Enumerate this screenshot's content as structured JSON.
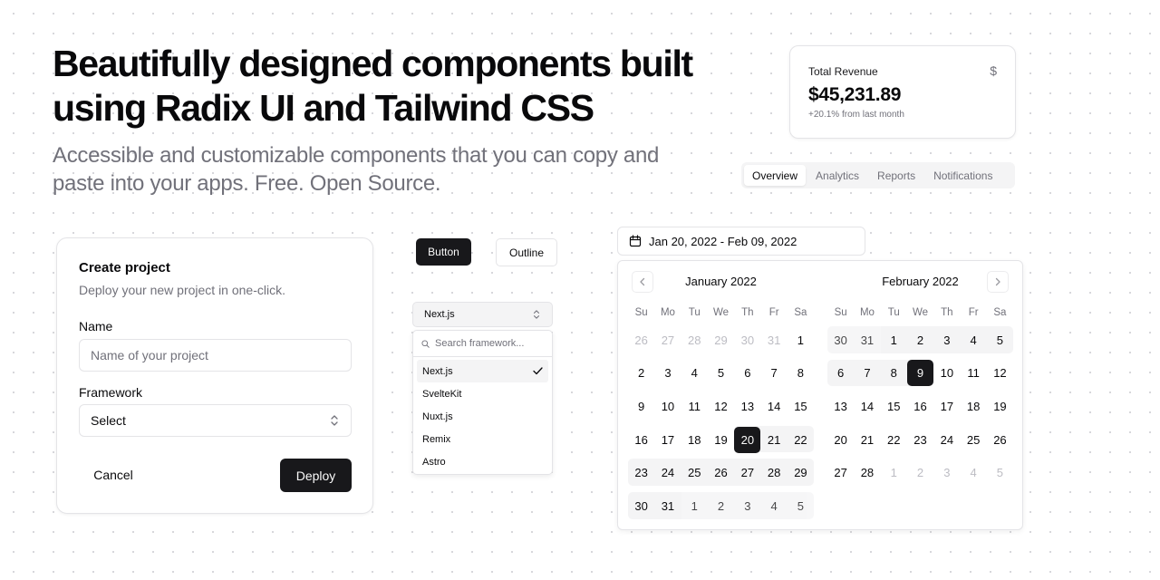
{
  "hero": {
    "title": "Beautifully designed components built using Radix UI and Tailwind CSS",
    "subtitle": "Accessible and customizable components that you can copy and paste into your apps. Free. Open Source."
  },
  "revenue_card": {
    "label": "Total Revenue",
    "icon": "dollar-icon",
    "icon_glyph": "$",
    "value": "$45,231.89",
    "delta": "+20.1% from last month"
  },
  "tabs": {
    "active": 0,
    "items": [
      {
        "label": "Overview"
      },
      {
        "label": "Analytics"
      },
      {
        "label": "Reports"
      },
      {
        "label": "Notifications"
      }
    ]
  },
  "create_project": {
    "title": "Create project",
    "description": "Deploy your new project in one-click.",
    "name_label": "Name",
    "name_placeholder": "Name of your project",
    "name_value": "",
    "framework_label": "Framework",
    "framework_value": "Select",
    "cancel_label": "Cancel",
    "deploy_label": "Deploy"
  },
  "buttons_demo": {
    "primary_label": "Button",
    "outline_label": "Outline"
  },
  "combobox": {
    "selected": "Next.js",
    "search_placeholder": "Search framework...",
    "options": [
      {
        "label": "Next.js",
        "checked": true
      },
      {
        "label": "SvelteKit",
        "checked": false
      },
      {
        "label": "Nuxt.js",
        "checked": false
      },
      {
        "label": "Remix",
        "checked": false
      },
      {
        "label": "Astro",
        "checked": false
      }
    ]
  },
  "date_range": {
    "display": "Jan 20, 2022 - Feb 09, 2022",
    "weekdays": [
      "Su",
      "Mo",
      "Tu",
      "We",
      "Th",
      "Fr",
      "Sa"
    ],
    "months": [
      {
        "title": "January 2022",
        "weeks": [
          [
            {
              "d": "26",
              "o": 1
            },
            {
              "d": "27",
              "o": 1
            },
            {
              "d": "28",
              "o": 1
            },
            {
              "d": "29",
              "o": 1
            },
            {
              "d": "30",
              "o": 1
            },
            {
              "d": "31",
              "o": 1
            },
            {
              "d": "1"
            }
          ],
          [
            {
              "d": "2"
            },
            {
              "d": "3"
            },
            {
              "d": "4"
            },
            {
              "d": "5"
            },
            {
              "d": "6"
            },
            {
              "d": "7"
            },
            {
              "d": "8"
            }
          ],
          [
            {
              "d": "9"
            },
            {
              "d": "10"
            },
            {
              "d": "11"
            },
            {
              "d": "12"
            },
            {
              "d": "13"
            },
            {
              "d": "14"
            },
            {
              "d": "15"
            }
          ],
          [
            {
              "d": "16"
            },
            {
              "d": "17"
            },
            {
              "d": "18"
            },
            {
              "d": "19"
            },
            {
              "d": "20",
              "s": 1,
              "r": 1
            },
            {
              "d": "21",
              "r": 1
            },
            {
              "d": "22",
              "r": 1
            }
          ],
          [
            {
              "d": "23",
              "r": 1
            },
            {
              "d": "24",
              "r": 1
            },
            {
              "d": "25",
              "r": 1
            },
            {
              "d": "26",
              "r": 1
            },
            {
              "d": "27",
              "r": 1
            },
            {
              "d": "28",
              "r": 1
            },
            {
              "d": "29",
              "r": 1
            }
          ],
          [
            {
              "d": "30",
              "r": 1
            },
            {
              "d": "31",
              "r": 1
            },
            {
              "d": "1",
              "o": 1,
              "r": 1
            },
            {
              "d": "2",
              "o": 1,
              "r": 1
            },
            {
              "d": "3",
              "o": 1,
              "r": 1
            },
            {
              "d": "4",
              "o": 1,
              "r": 1
            },
            {
              "d": "5",
              "o": 1,
              "r": 1
            }
          ]
        ]
      },
      {
        "title": "February 2022",
        "weeks": [
          [
            {
              "d": "30",
              "o": 1,
              "r": 1
            },
            {
              "d": "31",
              "o": 1,
              "r": 1
            },
            {
              "d": "1",
              "r": 1
            },
            {
              "d": "2",
              "r": 1
            },
            {
              "d": "3",
              "r": 1
            },
            {
              "d": "4",
              "r": 1
            },
            {
              "d": "5",
              "r": 1
            }
          ],
          [
            {
              "d": "6",
              "r": 1
            },
            {
              "d": "7",
              "r": 1
            },
            {
              "d": "8",
              "r": 1
            },
            {
              "d": "9",
              "s": 1,
              "r": 1
            },
            {
              "d": "10"
            },
            {
              "d": "11"
            },
            {
              "d": "12"
            }
          ],
          [
            {
              "d": "13"
            },
            {
              "d": "14"
            },
            {
              "d": "15"
            },
            {
              "d": "16"
            },
            {
              "d": "17"
            },
            {
              "d": "18"
            },
            {
              "d": "19"
            }
          ],
          [
            {
              "d": "20"
            },
            {
              "d": "21"
            },
            {
              "d": "22"
            },
            {
              "d": "23"
            },
            {
              "d": "24"
            },
            {
              "d": "25"
            },
            {
              "d": "26"
            }
          ],
          [
            {
              "d": "27"
            },
            {
              "d": "28"
            },
            {
              "d": "1",
              "o": 1
            },
            {
              "d": "2",
              "o": 1
            },
            {
              "d": "3",
              "o": 1
            },
            {
              "d": "4",
              "o": 1
            },
            {
              "d": "5",
              "o": 1
            }
          ]
        ]
      }
    ]
  }
}
